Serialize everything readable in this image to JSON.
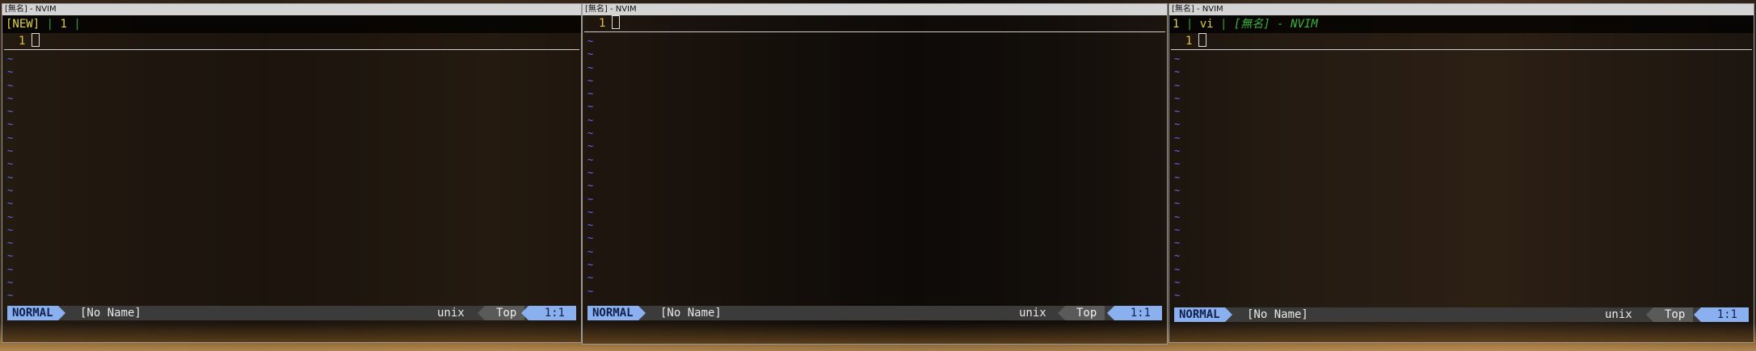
{
  "windows": [
    {
      "title": "[無名] - NVIM",
      "tabline": {
        "new": "[NEW]",
        "sep1": " | ",
        "num": "1",
        "sep2": " |"
      },
      "line_number": "1",
      "status": {
        "mode": "NORMAL",
        "file": "[No Name]",
        "format": "unix",
        "position": "Top",
        "cursor": "1:1"
      }
    },
    {
      "title": "[無名] - NVIM",
      "line_number": "1",
      "status": {
        "mode": "NORMAL",
        "file": "[No Name]",
        "format": "unix",
        "position": "Top",
        "cursor": "1:1"
      }
    },
    {
      "title": "[無名] - NVIM",
      "tabline": {
        "num": "1",
        "sep1": " | ",
        "cmd": "vi",
        "sep2": " | ",
        "name": "[無名] - NVIM"
      },
      "line_number": "1",
      "status": {
        "mode": "NORMAL",
        "file": "[No Name]",
        "format": "unix",
        "position": "Top",
        "cursor": "1:1"
      }
    }
  ],
  "tilde": "~",
  "colors": {
    "mode_bg": "#8ab0f0",
    "line_number": "#e6c43a",
    "tilde": "#6b6bff",
    "tab_green": "#3bb23b"
  }
}
